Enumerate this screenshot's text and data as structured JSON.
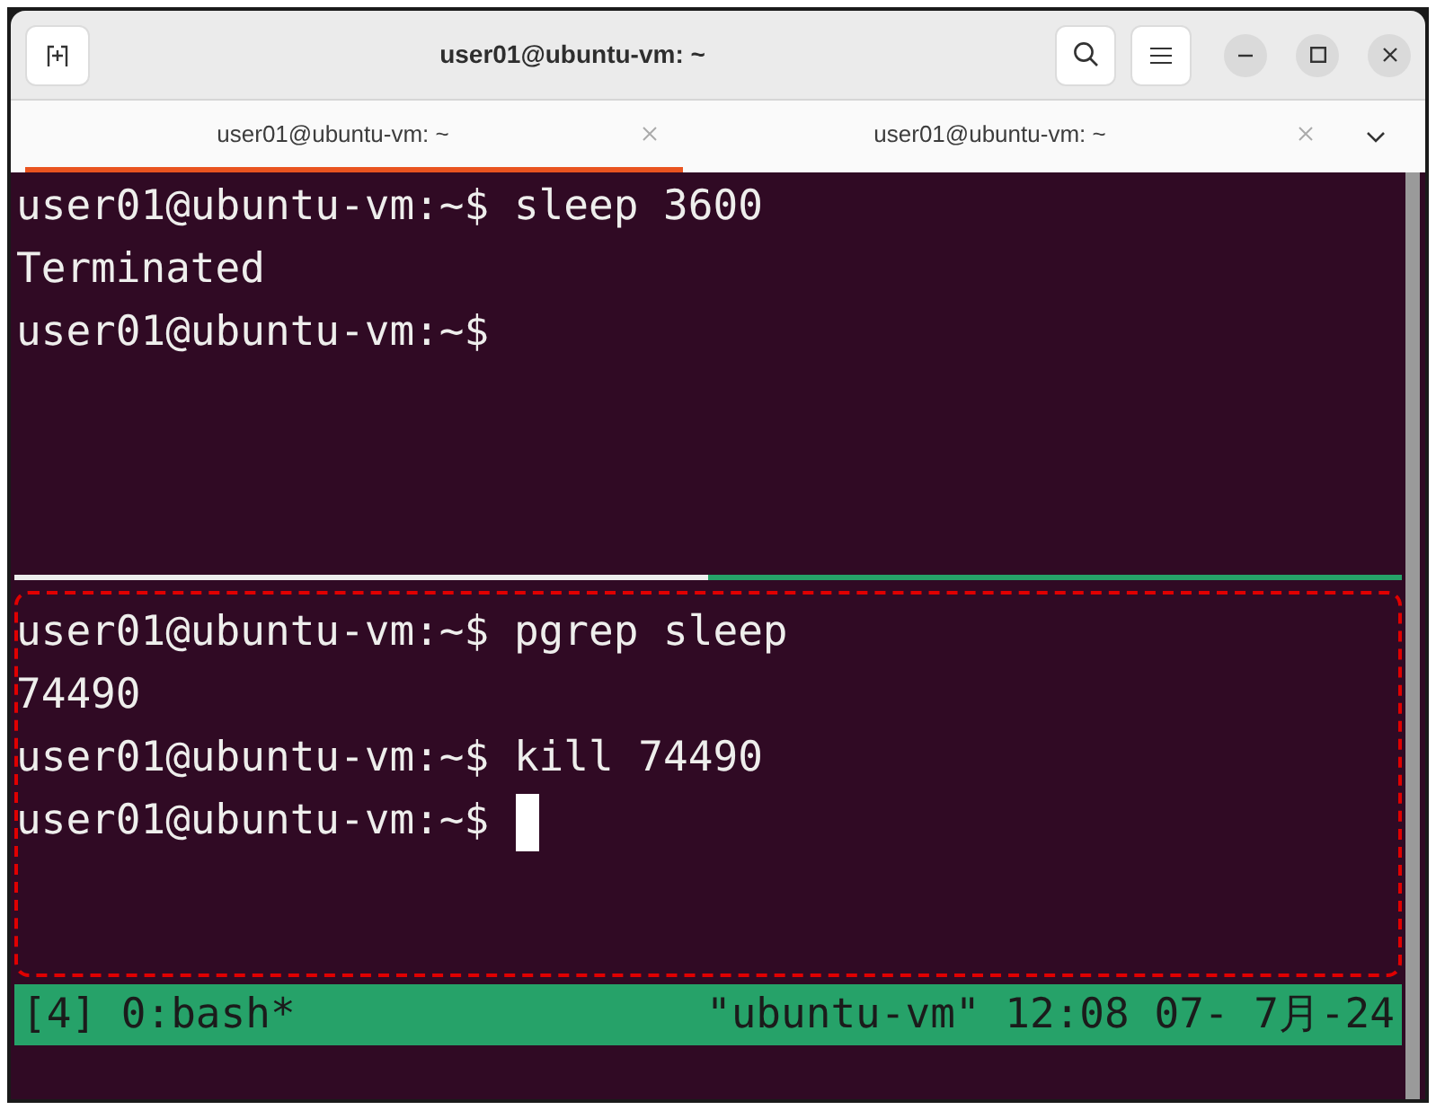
{
  "window": {
    "title": "user01@ubuntu-vm: ~"
  },
  "tabs": [
    {
      "label": "user01@ubuntu-vm: ~",
      "selected": true
    },
    {
      "label": "user01@ubuntu-vm: ~",
      "selected": false
    }
  ],
  "panes": [
    {
      "lines": [
        "user01@ubuntu-vm:~$ sleep 3600",
        "Terminated",
        "user01@ubuntu-vm:~$"
      ],
      "cursor": false,
      "highlighted": false
    },
    {
      "lines": [
        "user01@ubuntu-vm:~$ pgrep sleep",
        "74490",
        "user01@ubuntu-vm:~$ kill 74490",
        "user01@ubuntu-vm:~$"
      ],
      "cursor": true,
      "highlighted": true
    }
  ],
  "status_bar": {
    "left": "[4] 0:bash*",
    "right": "\"ubuntu-vm\" 12:08 07- 7月-24"
  }
}
